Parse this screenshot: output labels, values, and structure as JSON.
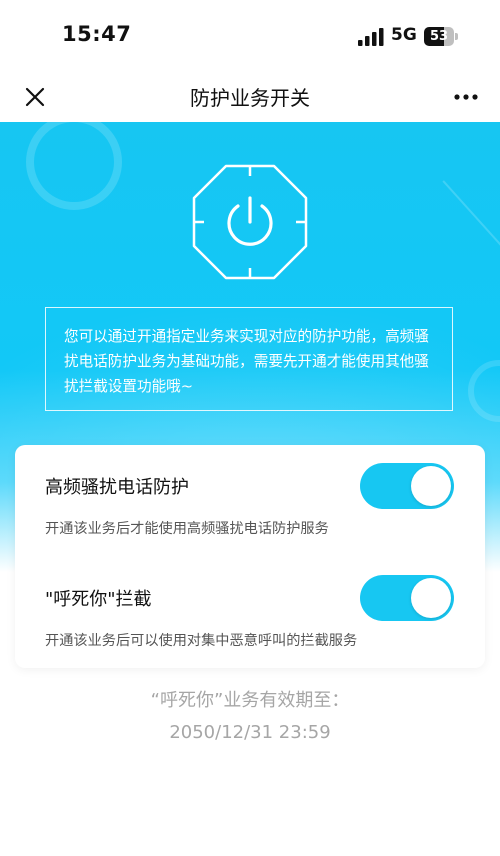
{
  "status_bar": {
    "time": "15:47",
    "network": "5G",
    "battery_level": "53",
    "icons": [
      "signal-bars-icon",
      "battery-icon"
    ]
  },
  "nav": {
    "title": "防护业务开关",
    "close_icon": "close-icon",
    "more_icon": "more-dots-icon"
  },
  "hero": {
    "emblem_icon": "power-shield-icon",
    "description": "您可以通过开通指定业务来实现对应的防护功能，高频骚扰电话防护业务为基础功能，需要先开通才能使用其他骚扰拦截设置功能哦~"
  },
  "services": [
    {
      "title": "高频骚扰电话防护",
      "description": "开通该业务后才能使用高频骚扰电话防护服务",
      "enabled": true
    },
    {
      "title": "\"呼死你\"拦截",
      "description": "开通该业务后可以使用对集中恶意呼叫的拦截服务",
      "enabled": true
    }
  ],
  "validity": {
    "label": "“呼死你”业务有效期至：",
    "date": "2050/12/31 23:59"
  },
  "colors": {
    "accent": "#17c7f2",
    "text_primary": "#111111",
    "text_secondary": "#555555",
    "text_muted": "#a6a6a6"
  }
}
